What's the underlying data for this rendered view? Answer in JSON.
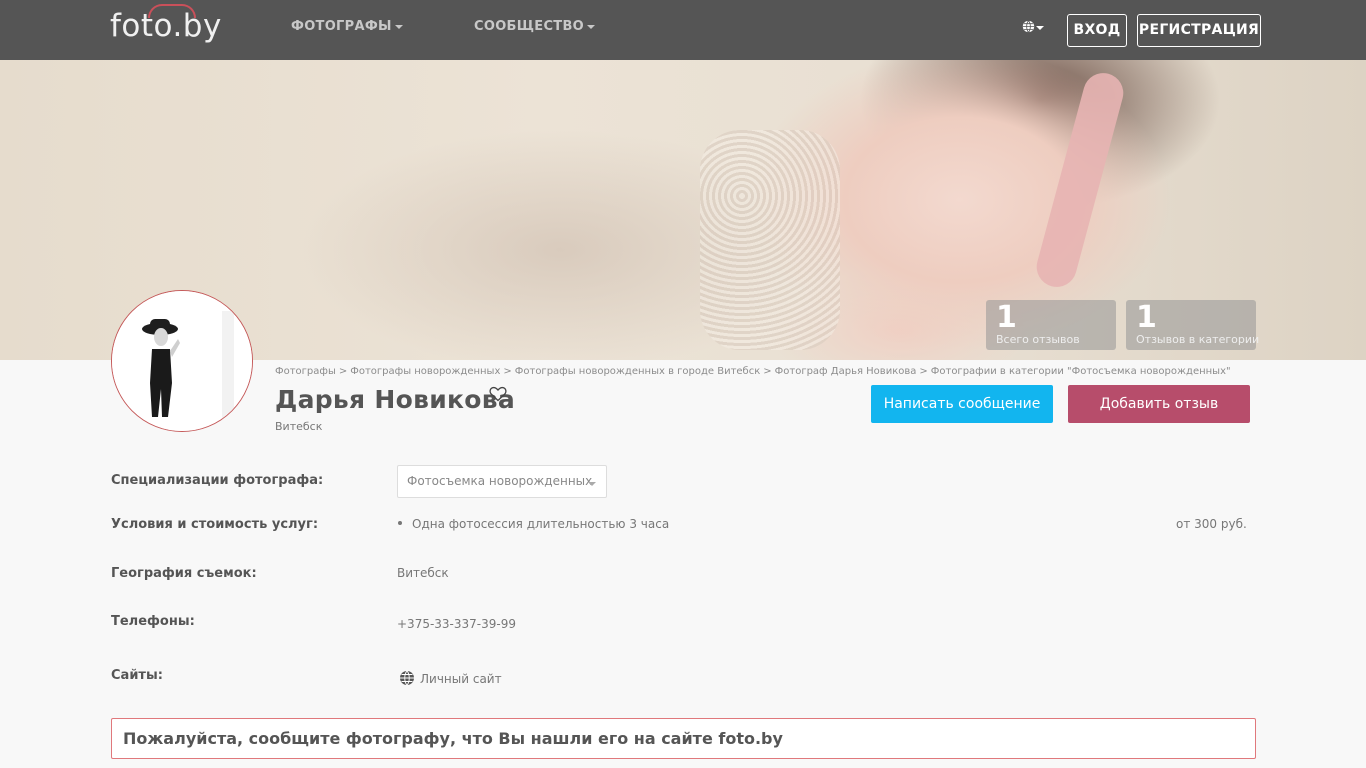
{
  "header": {
    "logo": "foto.by",
    "nav": [
      {
        "label": "ФОТОГРАФЫ"
      },
      {
        "label": "СООБЩЕСТВО"
      }
    ],
    "login": "ВХОД",
    "register": "РЕГИСТРАЦИЯ"
  },
  "stats": [
    {
      "value": "1",
      "label": "Всего отзывов"
    },
    {
      "value": "1",
      "label": "Отзывов в категории"
    }
  ],
  "breadcrumb": [
    "Фотографы",
    "Фотографы новорожденных",
    "Фотографы новорожденных в городе Витебск",
    "Фотограф Дарья Новикова",
    "Фотографии в категории \"Фотосъемка новорожденных\""
  ],
  "profile": {
    "name": "Дарья Новикова",
    "city": "Витебск",
    "message_button": "Написать сообщение",
    "review_button": "Добавить отзыв"
  },
  "info": {
    "specializations_label": "Специализации фотографа:",
    "specialization_selected": "Фотосъемка новорожденных",
    "conditions_label": "Условия и стоимость услуг:",
    "service": "Одна фотосессия длительностью 3 часа",
    "price": "от 300 руб.",
    "geography_label": "География съемок:",
    "geography": "Витебск",
    "phones_label": "Телефоны:",
    "phone": "+375-33-337-39-99",
    "sites_label": "Сайты:",
    "site": "Личный сайт"
  },
  "notice": "Пожалуйста, сообщите фотографу, что Вы нашли его на сайте foto.by",
  "colors": {
    "topbar": "#555555",
    "blue_button": "#12b5ef",
    "red_button": "#b74d6b",
    "notice_border": "#e0787c"
  }
}
